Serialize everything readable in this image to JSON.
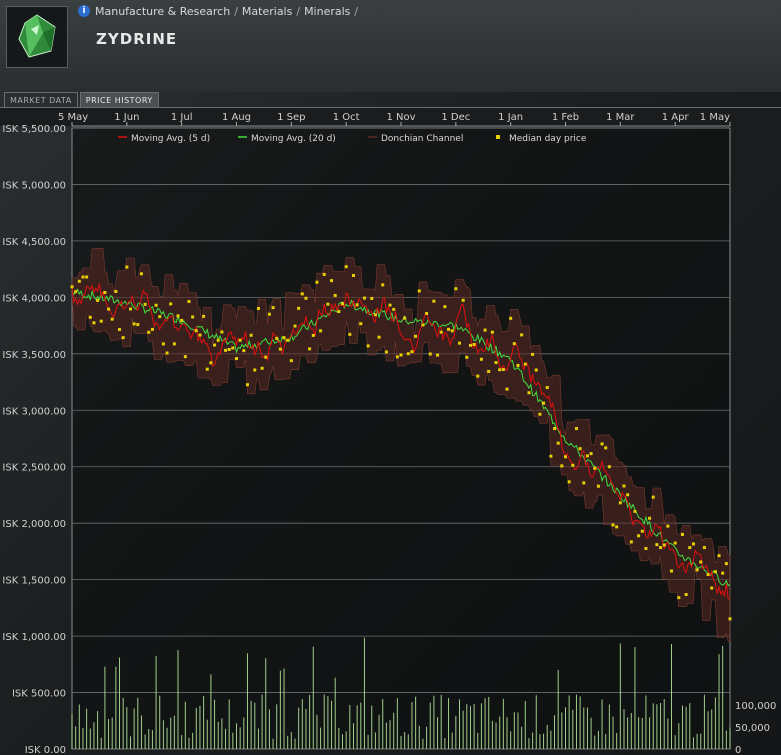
{
  "breadcrumb": {
    "items": [
      "Manufacture & Research",
      "Materials",
      "Minerals"
    ],
    "separator": "/"
  },
  "page_title": "ZYDRINE",
  "tabs": [
    {
      "label": "MARKET DATA",
      "active": false
    },
    {
      "label": "PRICE HISTORY",
      "active": true
    }
  ],
  "icons": {
    "item": "zydrine-mineral-icon",
    "info": "info-icon"
  },
  "chart_data": {
    "type": "line",
    "x_labels": [
      "5 May",
      "1 Jun",
      "1 Jul",
      "1 Aug",
      "1 Sep",
      "1 Oct",
      "1 Nov",
      "1 Dec",
      "1 Jan",
      "1 Feb",
      "1 Mar",
      "1 Apr",
      "1 May"
    ],
    "y_ticks": [
      "ISK 0.00",
      "ISK 500.00",
      "ISK 1,000.00",
      "ISK 1,500.00",
      "ISK 2,000.00",
      "ISK 2,500.00",
      "ISK 3,000.00",
      "ISK 3,500.00",
      "ISK 4,000.00",
      "ISK 4,500.00",
      "ISK 5,000.00",
      "ISK 5,500.00"
    ],
    "ylim": [
      0,
      5500
    ],
    "volume_ticks": [
      "100,000",
      "50,000",
      "0"
    ],
    "legend": [
      "Moving Avg. (5 d)",
      "Moving Avg. (20 d)",
      "Donchian Channel",
      "Median day price"
    ],
    "colors": {
      "ma5": "#e01010",
      "ma20": "#40e040",
      "donchian": "#5a2a22",
      "median": "#e8d000",
      "volume": "#b8f0a0"
    },
    "median_price_monthly": [
      4100,
      3950,
      3800,
      3500,
      3700,
      4000,
      3800,
      3750,
      3500,
      2700,
      2200,
      1700,
      1300
    ],
    "ma20_monthly": [
      4050,
      3950,
      3800,
      3550,
      3650,
      3950,
      3800,
      3750,
      3450,
      2750,
      2250,
      1750,
      1450
    ]
  }
}
